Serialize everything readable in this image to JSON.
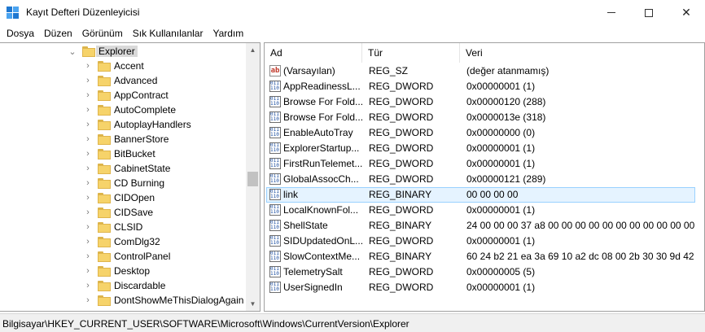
{
  "window": {
    "title": "Kayıt Defteri Düzenleyicisi"
  },
  "menu": [
    "Dosya",
    "Düzen",
    "Görünüm",
    "Sık Kullanılanlar",
    "Yardım"
  ],
  "tree": {
    "selected": "Explorer",
    "children": [
      "Accent",
      "Advanced",
      "AppContract",
      "AutoComplete",
      "AutoplayHandlers",
      "BannerStore",
      "BitBucket",
      "CabinetState",
      "CD Burning",
      "CIDOpen",
      "CIDSave",
      "CLSID",
      "ComDlg32",
      "ControlPanel",
      "Desktop",
      "Discardable",
      "DontShowMeThisDialogAgain"
    ]
  },
  "list": {
    "columns": [
      "Ad",
      "Tür",
      "Veri"
    ],
    "rows": [
      {
        "name": "(Varsayılan)",
        "type": "REG_SZ",
        "data": "(değer atanmamış)",
        "icon": "string-value-icon"
      },
      {
        "name": "AppReadinessL...",
        "type": "REG_DWORD",
        "data": "0x00000001 (1)",
        "icon": "binary-value-icon"
      },
      {
        "name": "Browse For Fold...",
        "type": "REG_DWORD",
        "data": "0x00000120 (288)",
        "icon": "binary-value-icon"
      },
      {
        "name": "Browse For Fold...",
        "type": "REG_DWORD",
        "data": "0x0000013e (318)",
        "icon": "binary-value-icon"
      },
      {
        "name": "EnableAutoTray",
        "type": "REG_DWORD",
        "data": "0x00000000 (0)",
        "icon": "binary-value-icon"
      },
      {
        "name": "ExplorerStartup...",
        "type": "REG_DWORD",
        "data": "0x00000001 (1)",
        "icon": "binary-value-icon"
      },
      {
        "name": "FirstRunTelemet...",
        "type": "REG_DWORD",
        "data": "0x00000001 (1)",
        "icon": "binary-value-icon"
      },
      {
        "name": "GlobalAssocCh...",
        "type": "REG_DWORD",
        "data": "0x00000121 (289)",
        "icon": "binary-value-icon"
      },
      {
        "name": "link",
        "type": "REG_BINARY",
        "data": "00 00 00 00",
        "icon": "binary-value-icon",
        "selected": true
      },
      {
        "name": "LocalKnownFol...",
        "type": "REG_DWORD",
        "data": "0x00000001 (1)",
        "icon": "binary-value-icon"
      },
      {
        "name": "ShellState",
        "type": "REG_BINARY",
        "data": "24 00 00 00 37 a8 00 00 00 00 00 00 00 00 00 00 00 ...",
        "icon": "binary-value-icon"
      },
      {
        "name": "SIDUpdatedOnL...",
        "type": "REG_DWORD",
        "data": "0x00000001 (1)",
        "icon": "binary-value-icon"
      },
      {
        "name": "SlowContextMe...",
        "type": "REG_BINARY",
        "data": "60 24 b2 21 ea 3a 69 10 a2 dc 08 00 2b 30 30 9d 42 0...",
        "icon": "binary-value-icon"
      },
      {
        "name": "TelemetrySalt",
        "type": "REG_DWORD",
        "data": "0x00000005 (5)",
        "icon": "binary-value-icon"
      },
      {
        "name": "UserSignedIn",
        "type": "REG_DWORD",
        "data": "0x00000001 (1)",
        "icon": "binary-value-icon"
      }
    ]
  },
  "status": {
    "path": "Bilgisayar\\HKEY_CURRENT_USER\\SOFTWARE\\Microsoft\\Windows\\CurrentVersion\\Explorer"
  }
}
